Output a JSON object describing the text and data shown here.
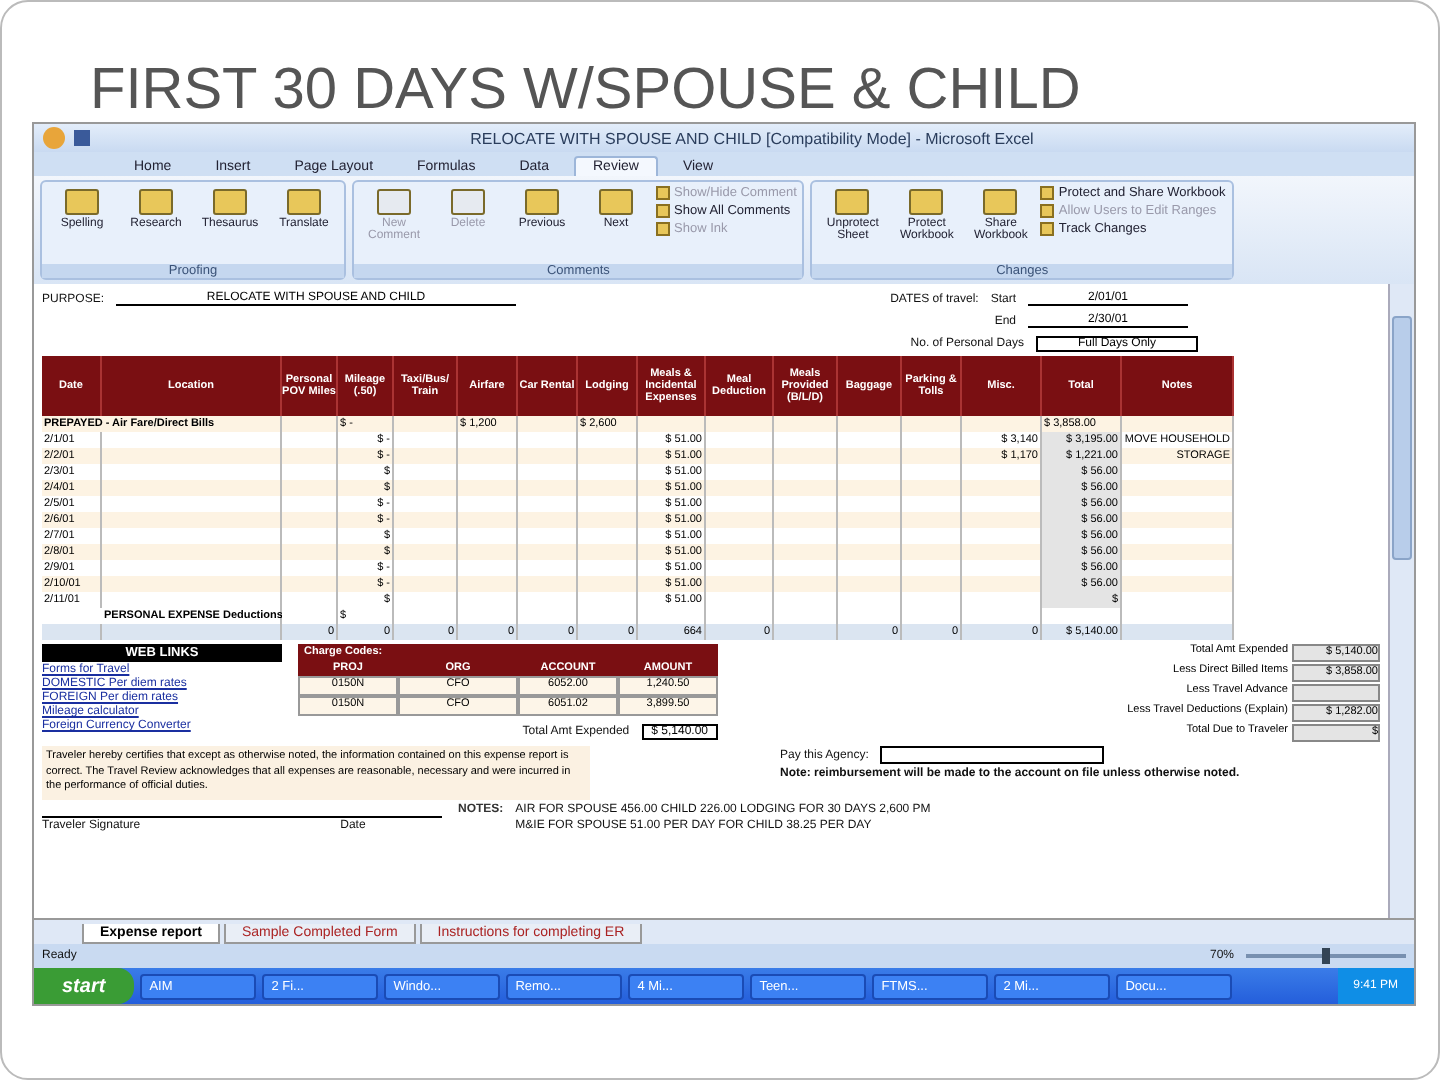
{
  "slide": {
    "title": "FIRST 30 DAYS W/SPOUSE & CHILD"
  },
  "window": {
    "title": "RELOCATE WITH SPOUSE AND CHILD  [Compatibility Mode]  -  Microsoft Excel"
  },
  "tabs": [
    {
      "label": "Home",
      "selected": false
    },
    {
      "label": "Insert",
      "selected": false
    },
    {
      "label": "Page Layout",
      "selected": false
    },
    {
      "label": "Formulas",
      "selected": false
    },
    {
      "label": "Data",
      "selected": false
    },
    {
      "label": "Review",
      "selected": true
    },
    {
      "label": "View",
      "selected": false
    }
  ],
  "ribbon": [
    {
      "label": "Proofing",
      "buttons": [
        {
          "kind": "large",
          "label": "Spelling",
          "disabled": false
        },
        {
          "kind": "large",
          "label": "Research",
          "disabled": false
        },
        {
          "kind": "large",
          "label": "Thesaurus",
          "disabled": false
        },
        {
          "kind": "large",
          "label": "Translate",
          "disabled": false
        }
      ]
    },
    {
      "label": "Comments",
      "buttons": [
        {
          "kind": "large",
          "label": "New Comment",
          "disabled": true
        },
        {
          "kind": "large",
          "label": "Delete",
          "disabled": true
        },
        {
          "kind": "large",
          "label": "Previous",
          "disabled": false
        },
        {
          "kind": "large",
          "label": "Next",
          "disabled": false
        },
        {
          "kind": "small",
          "label": "Show/Hide Comment",
          "disabled": true
        },
        {
          "kind": "small",
          "label": "Show All Comments",
          "disabled": false
        },
        {
          "kind": "small",
          "label": "Show Ink",
          "disabled": true
        }
      ]
    },
    {
      "label": "Changes",
      "buttons": [
        {
          "kind": "large",
          "label": "Unprotect Sheet",
          "disabled": false
        },
        {
          "kind": "large",
          "label": "Protect Workbook",
          "disabled": false
        },
        {
          "kind": "large",
          "label": "Share Workbook",
          "disabled": false
        },
        {
          "kind": "small",
          "label": "Protect and Share Workbook",
          "disabled": false
        },
        {
          "kind": "small",
          "label": "Allow Users to Edit Ranges",
          "disabled": true
        },
        {
          "kind": "small",
          "label": "Track Changes",
          "disabled": false
        }
      ]
    }
  ],
  "sheet": {
    "purpose_label": "PURPOSE:",
    "purpose": "RELOCATE WITH SPOUSE AND CHILD",
    "dates_label": "DATES of travel:",
    "start_label": "Start",
    "start": "2/01/01",
    "end_label": "End",
    "end": "2/30/01",
    "personal_days_label": "No. of Personal Days",
    "personal_days": "Full Days Only",
    "columns": [
      "Date",
      "Location",
      "Personal POV Miles",
      "Mileage (.50)",
      "Taxi/Bus/ Train",
      "Airfare",
      "Car Rental",
      "Lodging",
      "Meals & Incidental Expenses",
      "Meal Deduction",
      "Meals Provided (B/L/D)",
      "Baggage",
      "Parking & Tolls",
      "Misc.",
      "Total",
      "Notes"
    ],
    "rows": [
      {
        "kind": "prepaid",
        "cells": [
          "PREPAYED - Air Fare/Direct Bills",
          "",
          "$ -",
          "",
          "$ 1,200",
          "",
          "$ 2,600",
          "",
          "",
          "",
          "",
          "",
          "",
          "$ 3,858.00",
          ""
        ]
      },
      {
        "kind": "day",
        "cells": [
          "2/1/01",
          "",
          "",
          "$ -",
          "",
          "",
          "",
          "",
          "$ 51.00",
          "",
          "",
          "",
          "",
          "$ 3,140",
          "$ 3,195.00",
          "MOVE HOUSEHOLD"
        ]
      },
      {
        "kind": "day",
        "cells": [
          "2/2/01",
          "",
          "",
          "$ -",
          "",
          "",
          "",
          "",
          "$ 51.00",
          "",
          "",
          "",
          "",
          "$ 1,170",
          "$ 1,221.00",
          "STORAGE"
        ]
      },
      {
        "kind": "day",
        "cells": [
          "2/3/01",
          "",
          "",
          "$",
          "",
          "",
          "",
          "",
          "$ 51.00",
          "",
          "",
          "",
          "",
          "",
          "$ 56.00",
          ""
        ]
      },
      {
        "kind": "day",
        "cells": [
          "2/4/01",
          "",
          "",
          "$",
          "",
          "",
          "",
          "",
          "$ 51.00",
          "",
          "",
          "",
          "",
          "",
          "$ 56.00",
          ""
        ]
      },
      {
        "kind": "day",
        "cells": [
          "2/5/01",
          "",
          "",
          "$ -",
          "",
          "",
          "",
          "",
          "$ 51.00",
          "",
          "",
          "",
          "",
          "",
          "$ 56.00",
          ""
        ]
      },
      {
        "kind": "day",
        "cells": [
          "2/6/01",
          "",
          "",
          "$ -",
          "",
          "",
          "",
          "",
          "$ 51.00",
          "",
          "",
          "",
          "",
          "",
          "$ 56.00",
          ""
        ]
      },
      {
        "kind": "day",
        "cells": [
          "2/7/01",
          "",
          "",
          "$",
          "",
          "",
          "",
          "",
          "$ 51.00",
          "",
          "",
          "",
          "",
          "",
          "$ 56.00",
          ""
        ]
      },
      {
        "kind": "day",
        "cells": [
          "2/8/01",
          "",
          "",
          "$",
          "",
          "",
          "",
          "",
          "$ 51.00",
          "",
          "",
          "",
          "",
          "",
          "$ 56.00",
          ""
        ]
      },
      {
        "kind": "day",
        "cells": [
          "2/9/01",
          "",
          "",
          "$ -",
          "",
          "",
          "",
          "",
          "$ 51.00",
          "",
          "",
          "",
          "",
          "",
          "$ 56.00",
          ""
        ]
      },
      {
        "kind": "day",
        "cells": [
          "2/10/01",
          "",
          "",
          "$ -",
          "",
          "",
          "",
          "",
          "$ 51.00",
          "",
          "",
          "",
          "",
          "",
          "$ 56.00",
          ""
        ]
      },
      {
        "kind": "day",
        "cells": [
          "2/11/01",
          "",
          "",
          "$",
          "",
          "",
          "",
          "",
          "$ 51.00",
          "",
          "",
          "",
          "",
          "",
          "$",
          ""
        ]
      },
      {
        "kind": "deduction",
        "cells": [
          "",
          "PERSONAL EXPENSE Deductions",
          "",
          "$",
          "",
          "",
          "",
          "",
          "",
          "",
          "",
          "",
          "",
          "",
          "",
          ""
        ]
      },
      {
        "kind": "total",
        "cells": [
          "",
          "",
          "0",
          "0",
          "0",
          "0",
          "0",
          "0",
          "664",
          "0",
          "",
          "0",
          "0",
          "0",
          "$ 5,140.00",
          ""
        ]
      }
    ],
    "web_links_title": "WEB LINKS",
    "web_links": [
      "Forms for Travel",
      "DOMESTIC Per diem rates",
      "FOREIGN Per diem rates",
      "Mileage calculator",
      "Foreign Currency Converter"
    ],
    "charge_codes": {
      "title": "Charge Codes:",
      "columns": [
        "PROJ",
        "ORG",
        "ACCOUNT",
        "AMOUNT"
      ],
      "rows": [
        [
          "0150N",
          "CFO",
          "6052.00",
          "1,240.50"
        ],
        [
          "0150N",
          "CFO",
          "6051.02",
          "3,899.50"
        ]
      ],
      "total_label": "Total Amt Expended",
      "total": "$ 5,140.00"
    },
    "summary": [
      {
        "label": "Total Amt Expended",
        "value": "$ 5,140.00"
      },
      {
        "label": "Less Direct Billed Items",
        "value": "$ 3,858.00"
      },
      {
        "label": "Less Travel Advance"
      },
      {
        "label": "Less Travel Deductions (Explain)",
        "value": "$ 1,282.00"
      },
      {
        "label": "Total Due to Traveler",
        "value": "$"
      }
    ],
    "certification": "Traveler hereby certifies that except as otherwise noted, the information contained on this expense report is correct. The Travel Review acknowledges that all expenses are reasonable, necessary and were incurred in the performance of official duties.",
    "signature_label": "Traveler Signature",
    "date_label": "Date",
    "pay_label": "Pay this Agency:",
    "pay_note": "Note: reimbursement will be made to the account on file unless otherwise noted.",
    "notes_label": "NOTES:",
    "notes": [
      "AIR FOR SPOUSE 456.00 CHILD 226.00 LODGING FOR 30 DAYS 2,600 PM",
      "M&IE FOR SPOUSE 51.00 PER DAY FOR CHILD 38.25 PER DAY"
    ],
    "sheet_tabs": [
      {
        "label": "Expense report",
        "selected": true
      },
      {
        "label": "Sample Completed Form",
        "selected": false
      },
      {
        "label": "Instructions for completing ER",
        "selected": false
      }
    ]
  },
  "status_bar": {
    "status": "Ready",
    "zoom": "70%",
    "zoom_slider": {
      "level": 0.5
    }
  },
  "taskbar": {
    "start": "start",
    "items": [
      "AIM",
      "2 Fi...",
      "Windo...",
      "Remo...",
      "4 Mi...",
      "Teen...",
      "FTMS...",
      "2 Mi...",
      "Docu..."
    ],
    "clock": "9:41 PM"
  }
}
